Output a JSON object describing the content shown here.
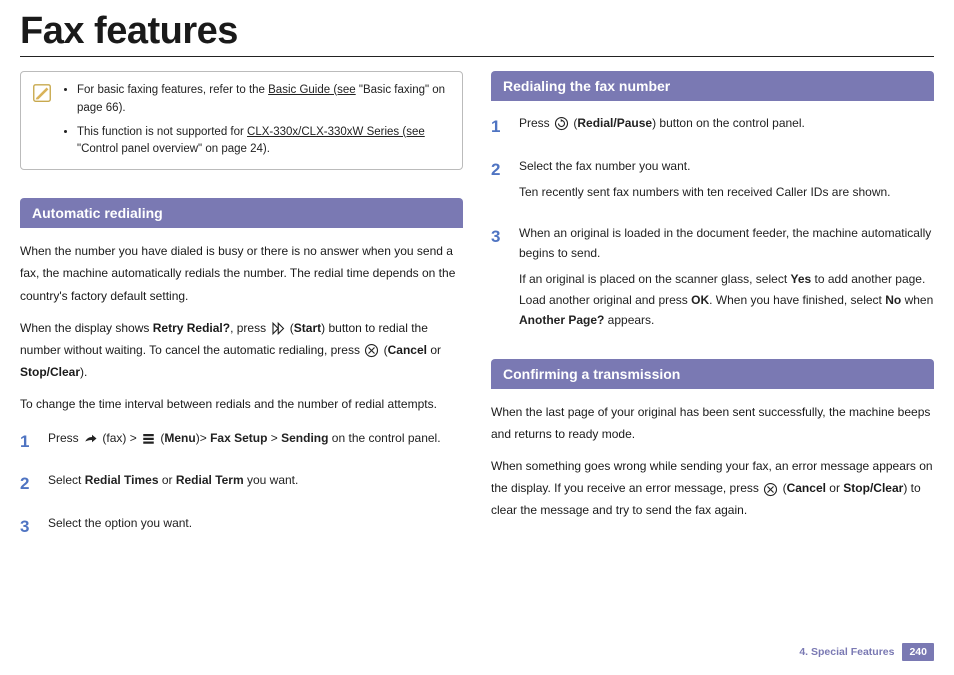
{
  "title": "Fax features",
  "notes": [
    {
      "pre": "For basic faxing features, refer to the ",
      "link": "Basic Guide (see",
      "post": " \"Basic faxing\" on page 66)."
    },
    {
      "pre": "This function is not supported for ",
      "link": "CLX-330x/CLX-330xW Series (see",
      "post": " \"Control panel overview\" on page 24)."
    }
  ],
  "left": {
    "heading": "Automatic redialing",
    "p1": "When the number you have dialed is busy or there is no answer when you send a fax, the machine automatically redials the number. The redial time depends on the country's factory default setting.",
    "p2a": " When the display shows ",
    "p2a_bold": "Retry Redial?",
    "p2b": ", press ",
    "p2c_bold": "Start",
    "p2d": ") button to redial the number without waiting. To cancel the automatic redialing, press ",
    "p2e_bold": "Cancel",
    "p2f": " or ",
    "p2g_bold": "Stop/Clear",
    "p2h": ").",
    "p3": "To change the time interval between redials and the number of redial attempts.",
    "step1_a": "Press ",
    "step1_b": " (fax) > ",
    "step1_c": " (",
    "step1_menu": "Menu",
    "step1_d": ")> ",
    "step1_faxsetup": "Fax Setup",
    "step1_e": " > ",
    "step1_sending": "Sending",
    "step1_f": " on the control panel.",
    "step2_a": "Select ",
    "step2_b": "Redial Times",
    "step2_c": " or ",
    "step2_d": "Redial Term",
    "step2_e": " you want.",
    "step3": "Select the option you want."
  },
  "right": {
    "heading1": "Redialing the fax number",
    "r1_a": "Press ",
    "r1_b": " (",
    "r1_c": "Redial/Pause",
    "r1_d": ") button on the control panel.",
    "r2_a": "Select the fax number you want.",
    "r2_b": "Ten recently sent fax numbers with ten received Caller IDs are shown.",
    "r3_a": "When an original is loaded in the document feeder, the machine automatically begins to send.",
    "r3_b1": "If an original is placed on the scanner glass, select ",
    "r3_yes": "Yes",
    "r3_b2": " to add another page. Load another original and press ",
    "r3_ok": "OK",
    "r3_b3": ". When you have finished, select ",
    "r3_no": "No",
    "r3_b4": " when ",
    "r3_ap": "Another Page?",
    "r3_b5": " appears.",
    "heading2": "Confirming a transmission",
    "c1": "When the last page of your original has been sent successfully, the machine beeps and returns to ready mode.",
    "c2a": "When something goes wrong while sending your fax, an error message appears on the display. If you receive an error message, press ",
    "c2b": " (",
    "c2_cancel": "Cancel",
    "c2c": " or ",
    "c2_stop": "Stop/Clear",
    "c2d": ") to clear the message and try to send the fax again."
  },
  "footer": {
    "section": "4.  Special Features",
    "page": "240"
  }
}
